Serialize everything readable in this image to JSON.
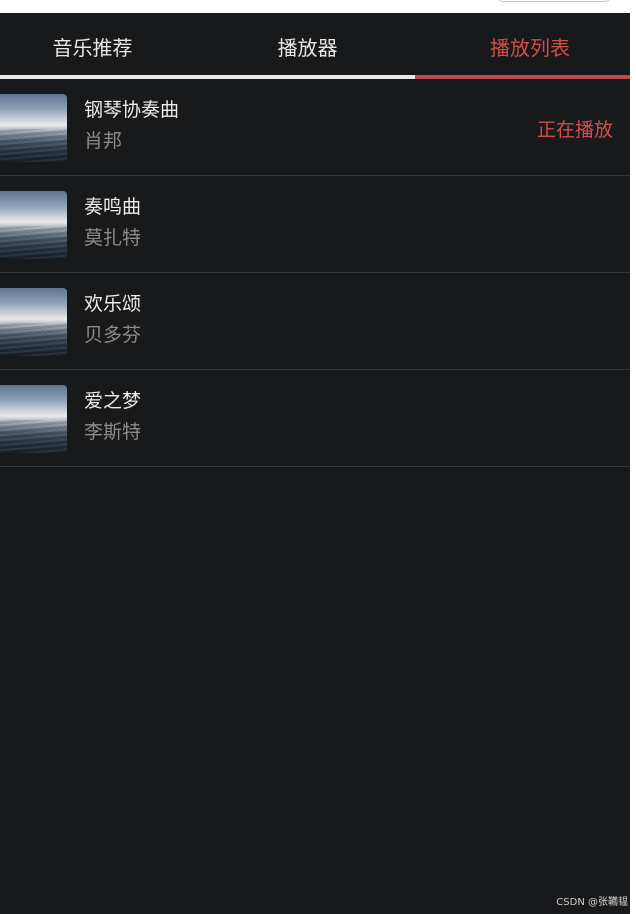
{
  "tabs": [
    {
      "label": "音乐推荐"
    },
    {
      "label": "播放器"
    },
    {
      "label": "播放列表"
    }
  ],
  "active_tab": "播放列表",
  "playlist": [
    {
      "title": "钢琴协奏曲",
      "artist": "肖邦",
      "status": "正在播放"
    },
    {
      "title": "奏鸣曲",
      "artist": "莫扎特",
      "status": ""
    },
    {
      "title": "欢乐颂",
      "artist": "贝多芬",
      "status": ""
    },
    {
      "title": "爱之梦",
      "artist": "李斯特",
      "status": ""
    }
  ],
  "watermark": "CSDN @张韉韫",
  "colors": {
    "background": "#18191b",
    "accent": "#d24c4c",
    "text": "#ececec",
    "muted": "#8b8b8b"
  }
}
